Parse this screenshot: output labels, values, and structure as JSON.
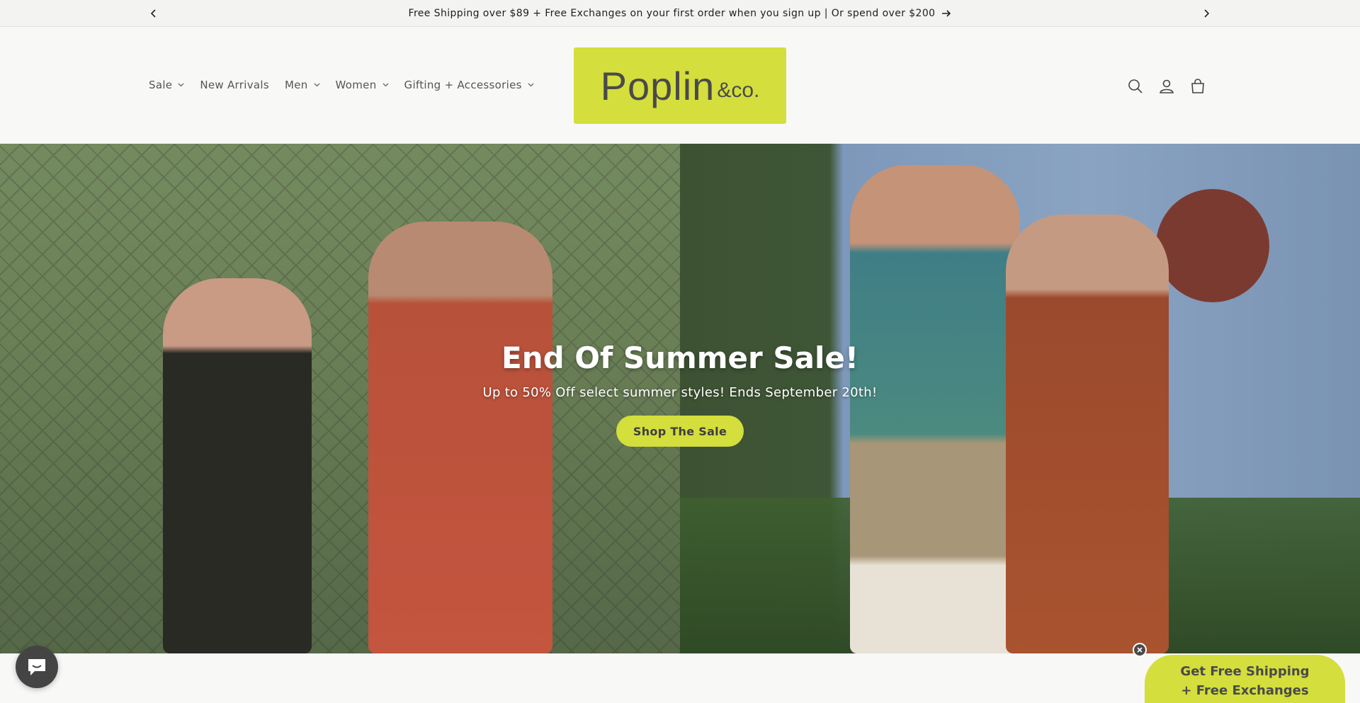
{
  "announcement": {
    "message": "Free Shipping over $89 + Free Exchanges on your first order when you sign up | Or spend over $200"
  },
  "nav": {
    "items": [
      {
        "label": "Sale",
        "has_dropdown": true
      },
      {
        "label": "New Arrivals",
        "has_dropdown": false
      },
      {
        "label": "Men",
        "has_dropdown": true
      },
      {
        "label": "Women",
        "has_dropdown": true
      },
      {
        "label": "Gifting + Accessories",
        "has_dropdown": true
      }
    ]
  },
  "logo": {
    "main": "Poplin",
    "sub": "&co."
  },
  "header_icons": [
    "search-icon",
    "account-icon",
    "cart-icon"
  ],
  "hero": {
    "title": "End Of Summer Sale!",
    "subtitle": "Up to 50% Off select summer styles! Ends September 20th!",
    "button_label": "Shop The Sale"
  },
  "promo": {
    "line1": "Get Free Shipping",
    "line2": "+ Free Exchanges"
  },
  "colors": {
    "accent": "#d4de3c",
    "text_dark": "#1e1e1e",
    "nav_text": "#555555",
    "background": "#f8f8f6"
  }
}
